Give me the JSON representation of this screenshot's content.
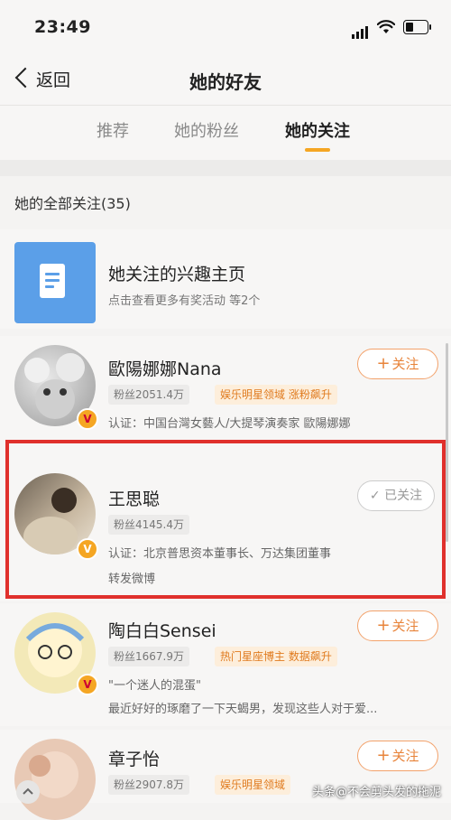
{
  "status_bar": {
    "time": "23:49"
  },
  "nav": {
    "back_label": "返回",
    "title": "她的好友"
  },
  "tabs": [
    {
      "label": "推荐"
    },
    {
      "label": "她的粉丝"
    },
    {
      "label": "她的关注"
    }
  ],
  "active_tab": "她的关注",
  "section": {
    "title": "她的全部关注(35)"
  },
  "interest": {
    "title": "她关注的兴趣主页",
    "subtitle": "点击查看更多有奖活动 等2个"
  },
  "users": [
    {
      "name": "歐陽娜娜Nana",
      "fans": "粉丝2051.4万",
      "tags": [
        "娱乐明星领域",
        "涨粉飙升"
      ],
      "desc1": "认证：中国台灣女藝人/大提琴演奏家 歐陽娜娜",
      "desc2": "",
      "button": "关注",
      "followed": false
    },
    {
      "name": "王思聪",
      "fans": "粉丝4145.4万",
      "tags": [],
      "desc1": "认证：北京普思资本董事长、万达集团董事",
      "desc2": "转发微博",
      "button": "已关注",
      "followed": true
    },
    {
      "name": "陶白白Sensei",
      "fans": "粉丝1667.9万",
      "tags": [
        "热门星座博主",
        "数据飙升"
      ],
      "desc1": "\"一个迷人的混蛋\"",
      "desc2": "最近好好的琢磨了一下天蝎男，发现这些人对于爱...",
      "button": "关注",
      "followed": false
    },
    {
      "name": "章子怡",
      "fans": "粉丝2907.8万",
      "tags": [
        "娱乐明星领域"
      ],
      "desc1": "",
      "desc2": "",
      "button": "关注",
      "followed": false
    }
  ],
  "watermark": "头条@不会剪头发的拖泥",
  "colors": {
    "accent": "#f5a623",
    "follow_orange": "#e8843b",
    "highlight_red": "#e0302c",
    "interest_blue": "#5b9fe8"
  }
}
